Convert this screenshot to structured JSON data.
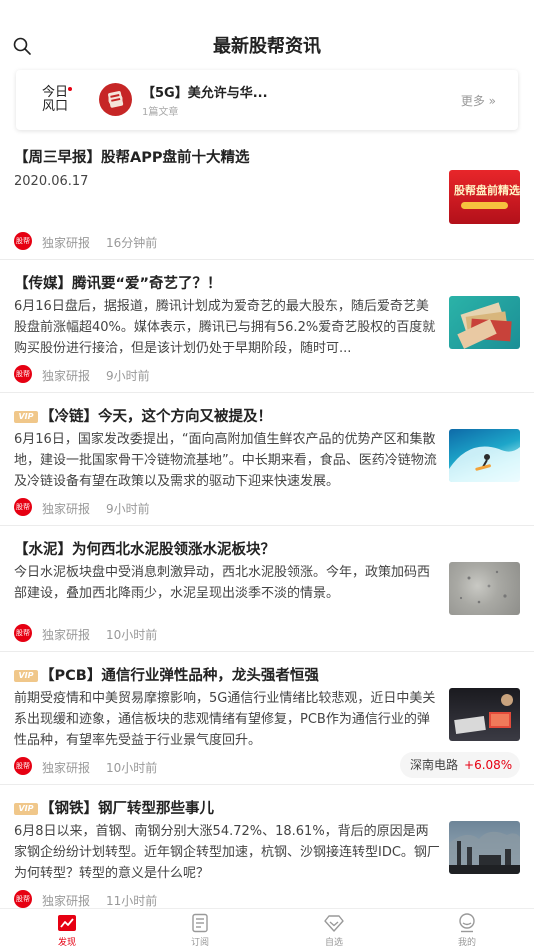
{
  "header": {
    "title": "最新股帮资讯"
  },
  "hot": {
    "logo_line1": "今日",
    "logo_line2": "风口",
    "title": "【5G】美允许与华...",
    "count": "1篇文章",
    "more": "更多 »"
  },
  "articles": [
    {
      "title": "【周三早报】股帮APP盘前十大精选",
      "date": "2020.06.17",
      "source": "独家研报",
      "time": "16分钟前",
      "thumb_text": "股帮盘前精选"
    },
    {
      "title": "【传媒】腾讯要“爱”奇艺了？！",
      "body": "6月16日盘后，据报道，腾讯计划成为爱奇艺的最大股东，随后爱奇艺美股盘前涨幅超40%。媒体表示，腾讯已与拥有56.2%爱奇艺股权的百度就购买股份进行接洽，但是该计划仍处于早期阶段，随时可...",
      "source": "独家研报",
      "time": "9小时前"
    },
    {
      "vip": true,
      "title": "【冷链】今天，这个方向又被提及！",
      "body": "6月16日，国家发改委提出，“面向高附加值生鲜农产品的优势产区和集散地，建设一批国家骨干冷链物流基地”。中长期来看，食品、医药冷链物流及冷链设备有望在政策以及需求的驱动下迎来快速发展。",
      "source": "独家研报",
      "time": "9小时前"
    },
    {
      "title": "【水泥】为何西北水泥股领涨水泥板块？",
      "body": "今日水泥板块盘中受消息刺激异动，西北水泥股领涨。今年，政策加码西部建设，叠加西北降雨少，水泥呈现出淡季不淡的情景。",
      "source": "独家研报",
      "time": "10小时前"
    },
    {
      "vip": true,
      "title": "【PCB】通信行业弹性品种，龙头强者恒强",
      "body": "前期受疫情和中美贸易摩擦影响，5G通信行业情绪比较悲观，近日中美关系出现缓和迹象，通信板块的悲观情绪有望修复，PCB作为通信行业的弹性品种，有望率先受益于行业景气度回升。",
      "source": "独家研报",
      "time": "10小时前",
      "stock_name": "深南电路",
      "stock_change": "+6.08%"
    },
    {
      "vip": true,
      "title": "【钢铁】钢厂转型那些事儿",
      "body": "6月8日以来，首钢、南钢分别大涨54.72%、18.61%，背后的原因是两家钢企纷纷计划转型。近年钢企转型加速，杭钢、沙钢接连转型IDC。钢厂为何转型？转型的意义是什么呢？",
      "source": "独家研报",
      "time": "11小时前"
    }
  ],
  "vip_label": "VIP",
  "source_logo_text": "股帮",
  "tabs": [
    {
      "label": "发现",
      "active": true
    },
    {
      "label": "订阅",
      "active": false
    },
    {
      "label": "自选",
      "active": false
    },
    {
      "label": "我的",
      "active": false
    }
  ],
  "colors": {
    "accent": "#e60012",
    "vip": "#f0c78a"
  }
}
